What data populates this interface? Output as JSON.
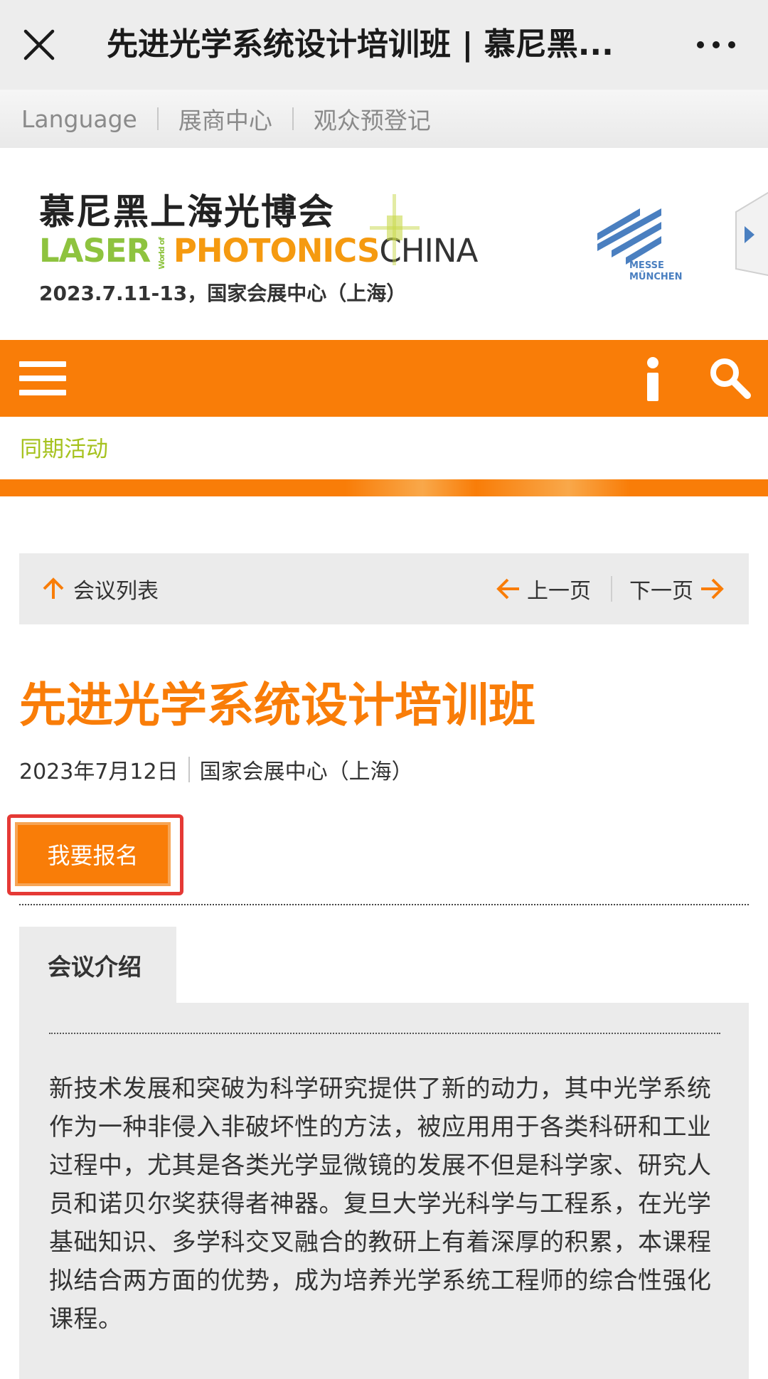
{
  "window": {
    "title": "先进光学系统设计培训班 | 慕尼黑..."
  },
  "lang_bar": {
    "items": [
      "Language",
      "展商中心",
      "观众预登记"
    ]
  },
  "logo": {
    "name_cn": "慕尼黑上海光博会",
    "name_en_laser": "LASER",
    "name_en_world_of": "World of",
    "name_en_photonics": "PHOTONICS",
    "name_en_china": "CHINA",
    "date_venue": "2023.7.11-13，国家会展中心（上海）",
    "messe_line1": "MESSE",
    "messe_line2": "MÜNCHEN"
  },
  "nav": {
    "breadcrumb": "同期活动"
  },
  "pager": {
    "list_label": "会议列表",
    "prev_label": "上一页",
    "next_label": "下一页"
  },
  "event": {
    "title": "先进光学系统设计培训班",
    "date": "2023年7月12日",
    "venue": "国家会展中心（上海）",
    "signup_label": "我要报名"
  },
  "intro": {
    "tab_label": "会议介绍",
    "text": "新技术发展和突破为科学研究提供了新的动力，其中光学系统作为一种非侵入非破坏性的方法，被应用用于各类科研和工业过程中，尤其是各类光学显微镜的发展不但是科学家、研究人员和诺贝尔奖获得者神器。复旦大学光科学与工程系，在光学基础知识、多学科交叉融合的教研上有着深厚的积累，本课程拟结合两方面的优势，成为培养光学系统工程师的综合性强化课程。"
  },
  "colors": {
    "accent_orange": "#f97d08",
    "breadcrumb_green": "#a6c21f",
    "highlight_red": "#e53935"
  }
}
